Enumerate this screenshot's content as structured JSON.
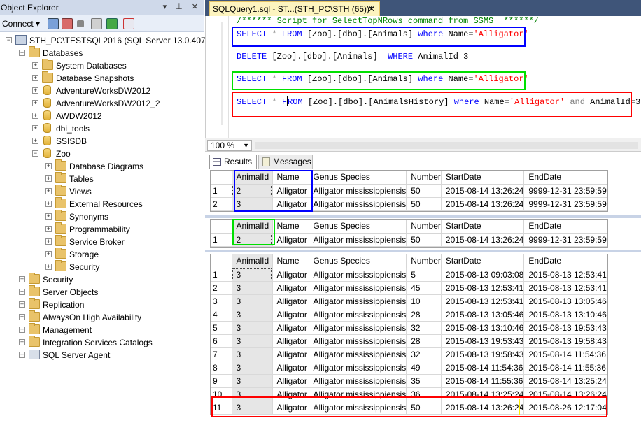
{
  "object_explorer": {
    "title": "Object Explorer",
    "title_buttons": "▾ ⊥ ✕",
    "toolbar": {
      "connect_label": "Connect ▾"
    },
    "tree": [
      {
        "label": "STH_PC\\TESTSQL2016 (SQL Server 13.0.407 - ST",
        "icon": "server-icon",
        "exp": "−"
      },
      {
        "label": "Databases",
        "icon": "folder-icon",
        "exp": "−"
      },
      {
        "label": "System Databases",
        "icon": "folder-icon",
        "exp": "+"
      },
      {
        "label": "Database Snapshots",
        "icon": "folder-icon",
        "exp": "+"
      },
      {
        "label": "AdventureWorksDW2012",
        "icon": "database-icon",
        "exp": "+"
      },
      {
        "label": "AdventureWorksDW2012_2",
        "icon": "database-icon",
        "exp": "+"
      },
      {
        "label": "AWDW2012",
        "icon": "database-icon",
        "exp": "+"
      },
      {
        "label": "dbi_tools",
        "icon": "database-icon",
        "exp": "+"
      },
      {
        "label": "SSISDB",
        "icon": "database-icon",
        "exp": "+"
      },
      {
        "label": "Zoo",
        "icon": "database-icon",
        "exp": "−"
      },
      {
        "label": "Database Diagrams",
        "icon": "folder-icon",
        "exp": "+"
      },
      {
        "label": "Tables",
        "icon": "folder-icon",
        "exp": "+"
      },
      {
        "label": "Views",
        "icon": "folder-icon",
        "exp": "+"
      },
      {
        "label": "External Resources",
        "icon": "folder-icon",
        "exp": "+"
      },
      {
        "label": "Synonyms",
        "icon": "folder-icon",
        "exp": "+"
      },
      {
        "label": "Programmability",
        "icon": "folder-icon",
        "exp": "+"
      },
      {
        "label": "Service Broker",
        "icon": "folder-icon",
        "exp": "+"
      },
      {
        "label": "Storage",
        "icon": "folder-icon",
        "exp": "+"
      },
      {
        "label": "Security",
        "icon": "folder-icon",
        "exp": "+"
      },
      {
        "label": "Security",
        "icon": "folder-icon",
        "exp": "+"
      },
      {
        "label": "Server Objects",
        "icon": "folder-icon",
        "exp": "+"
      },
      {
        "label": "Replication",
        "icon": "folder-icon",
        "exp": "+"
      },
      {
        "label": "AlwaysOn High Availability",
        "icon": "folder-icon",
        "exp": "+"
      },
      {
        "label": "Management",
        "icon": "folder-icon",
        "exp": "+"
      },
      {
        "label": "Integration Services Catalogs",
        "icon": "folder-icon",
        "exp": "+"
      },
      {
        "label": "SQL Server Agent",
        "icon": "agent-icon",
        "exp": "+"
      }
    ]
  },
  "query_window": {
    "tab_title": "SQLQuery1.sql - ST...(STH_PC\\STH (65))*",
    "tab_close": "✕",
    "zoom": "100 %",
    "code": {
      "comment": "/****** Script for SelectTopNRows command from SSMS  ******/",
      "line1": {
        "kw1": "SELECT",
        "op1": "*",
        "kw2": "FROM",
        "obj": "[Zoo].[dbo].[Animals]",
        "kw3": "where",
        "col": "Name",
        "eq": "=",
        "str": "'Alligator'"
      },
      "line2": {
        "kw1": "DELETE",
        "obj": "[Zoo].[dbo].[Animals]",
        "kw2": "WHERE",
        "rest": "AnimalId",
        "eq": "=",
        "num": "3"
      },
      "line3": {
        "kw1": "SELECT",
        "op1": "*",
        "kw2": "FROM",
        "obj": "[Zoo].[dbo].[Animals]",
        "kw3": "where",
        "col": "Name",
        "eq": "=",
        "str": "'Alligator'"
      },
      "line4": {
        "kw1": "SELECT",
        "op1": "*",
        "kw2a": "F",
        "kw2b": "ROM",
        "obj": "[Zoo].[dbo].[AnimalsHistory]",
        "kw3": "where",
        "col": "Name",
        "eq": "=",
        "str": "'Alligator'",
        "and": "and",
        "col2": "AnimalId",
        "eq2": "=",
        "num": "3"
      }
    },
    "result_tabs": {
      "results": "Results",
      "messages": "Messages"
    },
    "highlight_colors": {
      "blue": "#0000ff",
      "green": "#00e000",
      "red": "#ff0000",
      "yellow": "#ffee00"
    },
    "grids": [
      {
        "columns": [
          "",
          "AnimalId",
          "Name",
          "Genus Species",
          "Number",
          "StartDate",
          "EndDate"
        ],
        "rows": [
          [
            "1",
            "2",
            "Alligator",
            "Alligator mississippiensis",
            "50",
            "2015-08-14 13:26:24",
            "9999-12-31 23:59:59"
          ],
          [
            "2",
            "3",
            "Alligator",
            "Alligator mississippiensis",
            "50",
            "2015-08-14 13:26:24",
            "9999-12-31 23:59:59"
          ]
        ]
      },
      {
        "columns": [
          "",
          "AnimalId",
          "Name",
          "Genus Species",
          "Number",
          "StartDate",
          "EndDate"
        ],
        "rows": [
          [
            "1",
            "2",
            "Alligator",
            "Alligator mississippiensis",
            "50",
            "2015-08-14 13:26:24",
            "9999-12-31 23:59:59"
          ]
        ]
      },
      {
        "columns": [
          "",
          "AnimalId",
          "Name",
          "Genus Species",
          "Number",
          "StartDate",
          "EndDate"
        ],
        "rows": [
          [
            "1",
            "3",
            "Alligator",
            "Alligator mississippiensis",
            "5",
            "2015-08-13 09:03:08",
            "2015-08-13 12:53:41"
          ],
          [
            "2",
            "3",
            "Alligator",
            "Alligator mississippiensis",
            "45",
            "2015-08-13 12:53:41",
            "2015-08-13 12:53:41"
          ],
          [
            "3",
            "3",
            "Alligator",
            "Alligator mississippiensis",
            "10",
            "2015-08-13 12:53:41",
            "2015-08-13 13:05:46"
          ],
          [
            "4",
            "3",
            "Alligator",
            "Alligator mississippiensis",
            "28",
            "2015-08-13 13:05:46",
            "2015-08-13 13:10:46"
          ],
          [
            "5",
            "3",
            "Alligator",
            "Alligator mississippiensis",
            "32",
            "2015-08-13 13:10:46",
            "2015-08-13 19:53:43"
          ],
          [
            "6",
            "3",
            "Alligator",
            "Alligator mississippiensis",
            "28",
            "2015-08-13 19:53:43",
            "2015-08-13 19:58:43"
          ],
          [
            "7",
            "3",
            "Alligator",
            "Alligator mississippiensis",
            "32",
            "2015-08-13 19:58:43",
            "2015-08-14 11:54:36"
          ],
          [
            "8",
            "3",
            "Alligator",
            "Alligator mississippiensis",
            "49",
            "2015-08-14 11:54:36",
            "2015-08-14 11:55:36"
          ],
          [
            "9",
            "3",
            "Alligator",
            "Alligator mississippiensis",
            "35",
            "2015-08-14 11:55:36",
            "2015-08-14 13:25:24"
          ],
          [
            "10",
            "3",
            "Alligator",
            "Alligator mississippiensis",
            "36",
            "2015-08-14 13:25:24",
            "2015-08-14 13:26:24"
          ],
          [
            "11",
            "3",
            "Alligator",
            "Alligator mississippiensis",
            "50",
            "2015-08-14 13:26:24",
            "2015-08-26 12:17:04"
          ]
        ]
      }
    ]
  }
}
